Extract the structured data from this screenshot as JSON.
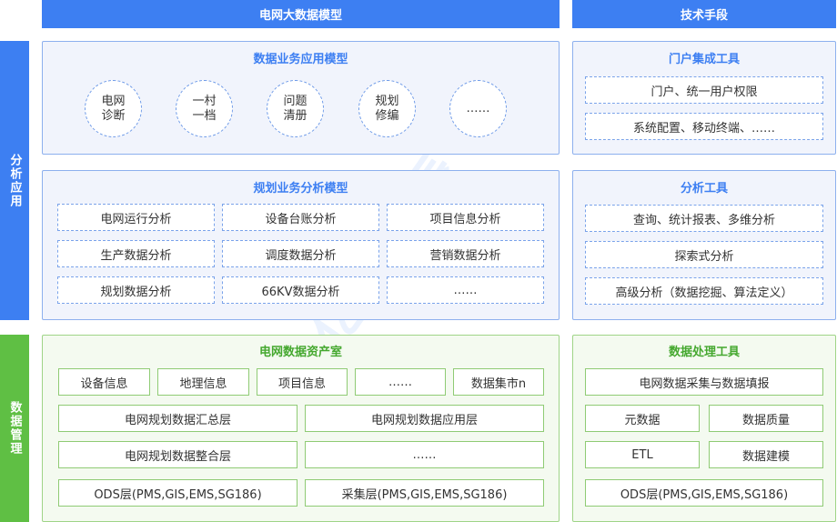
{
  "header": {
    "left": "电网大数据模型",
    "right": "技术手段"
  },
  "side": {
    "analysis": "分析应用",
    "data": "数据管理"
  },
  "business_panel": {
    "title": "数据业务应用模型",
    "circles": [
      "电网\n诊断",
      "一村\n一档",
      "问题\n清册",
      "规划\n修编",
      "……"
    ]
  },
  "portal_panel": {
    "title": "门户集成工具",
    "items": [
      "门户、统一用户权限",
      "系统配置、移动终端、……"
    ]
  },
  "planning_panel": {
    "title": "规划业务分析模型",
    "items": [
      "电网运行分析",
      "设备台账分析",
      "项目信息分析",
      "生产数据分析",
      "调度数据分析",
      "营销数据分析",
      "规划数据分析",
      "66KV数据分析",
      "……"
    ]
  },
  "analysis_tools": {
    "title": "分析工具",
    "items": [
      "查询、统计报表、多维分析",
      "探索式分析",
      "高级分析（数据挖掘、算法定义）"
    ]
  },
  "asset_panel": {
    "title": "电网数据资产室",
    "row1": [
      "设备信息",
      "地理信息",
      "项目信息",
      "……",
      "数据集市n"
    ],
    "summary_layer": "电网规划数据汇总层",
    "application_layer": "电网规划数据应用层",
    "integration_layer": "电网规划数据整合层",
    "etc": "……",
    "ods_layer": "ODS层(PMS,GIS,EMS,SG186)",
    "collect_layer": "采集层(PMS,GIS,EMS,SG186)"
  },
  "processing_tools": {
    "title": "数据处理工具",
    "collect": "电网数据采集与数据填报",
    "metadata": "元数据",
    "quality": "数据质量",
    "etl": "ETL",
    "modeling": "数据建模",
    "ods": "ODS层(PMS,GIS,EMS,SG186)"
  },
  "colors": {
    "blue": "#3d7ff2",
    "green": "#5fbf44"
  }
}
